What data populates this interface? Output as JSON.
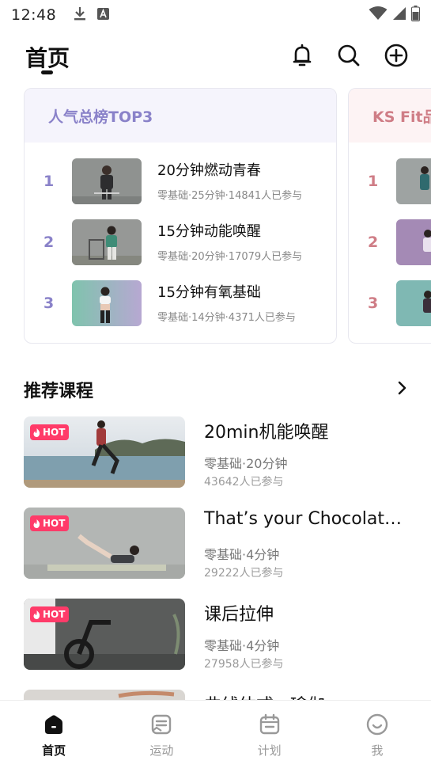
{
  "status_bar": {
    "time": "12:48"
  },
  "header": {
    "title": "首页"
  },
  "rank_cards": [
    {
      "title": "人气总榜TOP3",
      "title_color": "#8a82c9",
      "header_bg": "#f5f4fc",
      "num_color": "#8a82c9",
      "items": [
        {
          "rank": "1",
          "title": "20分钟燃动青春",
          "meta": "零基础·25分钟·14841人已参与"
        },
        {
          "rank": "2",
          "title": "15分钟动能唤醒",
          "meta": "零基础·20分钟·17079人已参与"
        },
        {
          "rank": "3",
          "title": "15分钟有氧基础",
          "meta": "零基础·14分钟·4371人已参与"
        }
      ]
    },
    {
      "title": "KS Fit品",
      "title_color": "#cf7d86",
      "header_bg": "#fdf3f4",
      "num_color": "#cf7d86",
      "items": [
        {
          "rank": "1"
        },
        {
          "rank": "2"
        },
        {
          "rank": "3"
        }
      ]
    }
  ],
  "recommend": {
    "title": "推荐课程",
    "courses": [
      {
        "badge": "HOT",
        "title": "20min机能唤醒",
        "meta": "零基础·20分钟",
        "count": "43642人已参与"
      },
      {
        "badge": "HOT",
        "title": "That’s your Chocolate Ca",
        "meta": "零基础·4分钟",
        "count": "29222人已参与"
      },
      {
        "badge": "HOT",
        "title": "课后拉伸",
        "meta": "零基础·4分钟",
        "count": "27958人已参与"
      },
      {
        "title": "曲线体式 · 瑜伽"
      }
    ]
  },
  "tabs": [
    {
      "label": "首页",
      "icon": "home-icon",
      "active": true
    },
    {
      "label": "运动",
      "icon": "sport-icon",
      "active": false
    },
    {
      "label": "计划",
      "icon": "calendar-icon",
      "active": false
    },
    {
      "label": "我",
      "icon": "profile-icon",
      "active": false
    }
  ],
  "colors": {
    "hot_badge": "#ff3b69",
    "text_primary": "#111111",
    "text_secondary": "#888888"
  }
}
